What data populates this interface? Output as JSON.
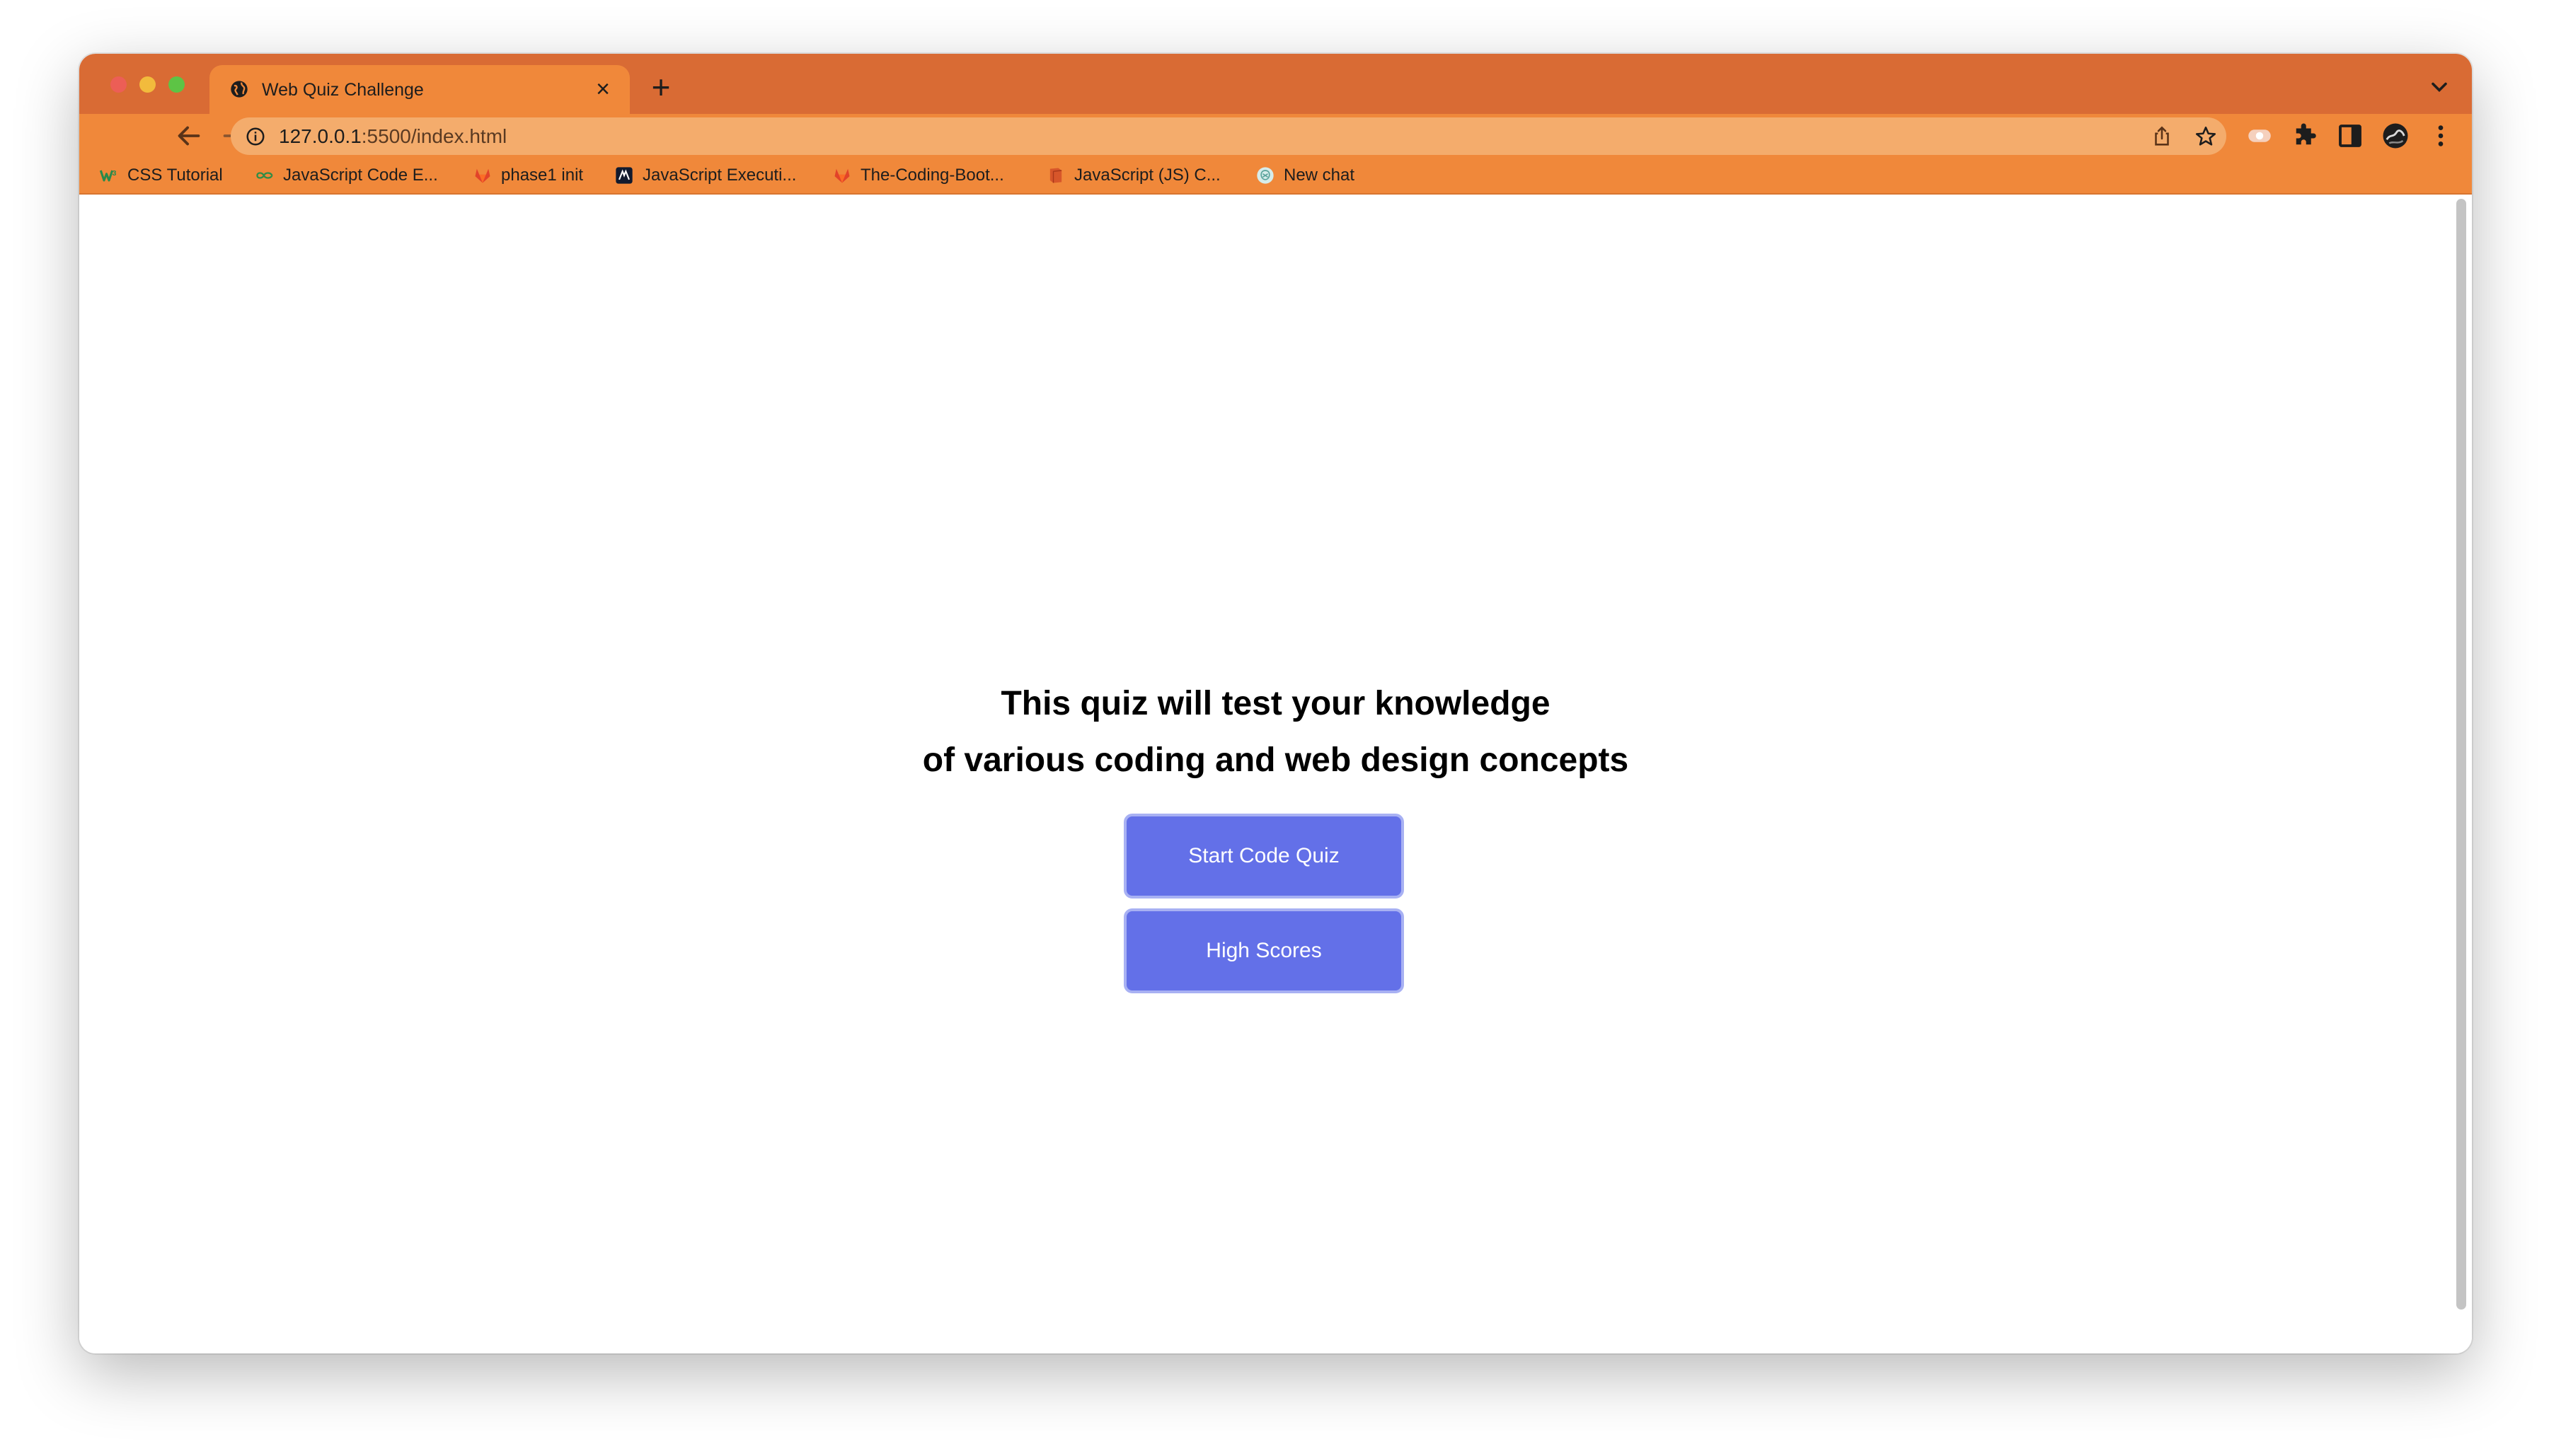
{
  "browser": {
    "tab": {
      "title": "Web Quiz Challenge",
      "close_label": "×",
      "favicon": "globe-icon"
    },
    "new_tab_label": "+",
    "address_bar": {
      "host": "127.0.0.1",
      "path": ":5500/index.html",
      "info_icon": "info-icon"
    },
    "toolbar_icons": [
      "back-icon",
      "forward-icon",
      "reload-icon",
      "share-icon",
      "bookmark-star-icon",
      "extension-record-icon",
      "puzzle-icon",
      "sidepanel-icon",
      "profile-avatar",
      "more-menu-icon"
    ],
    "bookmarks": [
      {
        "label": "CSS Tutorial",
        "icon": "w3schools-icon"
      },
      {
        "label": "JavaScript Code E...",
        "icon": "geeksforgeeks-icon"
      },
      {
        "label": "phase1 init",
        "icon": "gitlab-icon"
      },
      {
        "label": "JavaScript Executi...",
        "icon": "medium-icon"
      },
      {
        "label": "The-Coding-Boot...",
        "icon": "gitlab-icon"
      },
      {
        "label": "JavaScript (JS) C...",
        "icon": "book-icon"
      },
      {
        "label": "New chat",
        "icon": "chatgpt-icon"
      }
    ],
    "colors": {
      "frame": "#d96b34",
      "toolbar": "#f0883a",
      "omnibox": "#f4ac6c"
    }
  },
  "page": {
    "heading_line1": "This quiz will test your knowledge",
    "heading_line2": "of various coding and web design concepts",
    "start_button": "Start Code Quiz",
    "scores_button": "High Scores",
    "button_color": "#6370e8"
  }
}
